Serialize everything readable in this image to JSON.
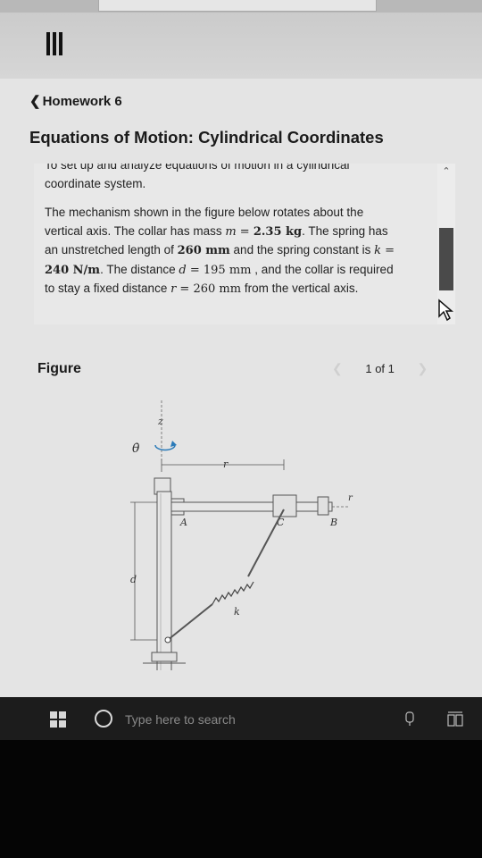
{
  "nav": {
    "back_label": "Homework 6"
  },
  "page": {
    "title": "Equations of Motion: Cylindrical Coordinates"
  },
  "problem": {
    "cut_line": "To set up and analyze equations of motion in a cylindrical",
    "intro_tail": "coordinate system.",
    "p1": "The mechanism shown in the figure below rotates about the vertical axis. The collar has mass ",
    "m_sym": "m",
    "eq": " = ",
    "m_val": "2.35 kg",
    "p2": ". The spring has an unstretched length of ",
    "len_val": "260 mm",
    "p3": " and the spring constant is ",
    "k_sym": "k",
    "k_val": "240 N/m",
    "p4": ". The distance ",
    "d_sym": "d",
    "d_val": "195 mm",
    "p5": " , and the collar is required to stay a fixed distance ",
    "r_sym": "r",
    "r_val": "260 mm",
    "p6": " from the vertical axis."
  },
  "figure_panel": {
    "label": "Figure",
    "pager": "1 of 1",
    "prev_icon": "chevron-left-icon",
    "next_icon": "chevron-right-icon",
    "labels": {
      "z": "z",
      "theta_dot": "θ̇",
      "r_top": "r",
      "r_right": "r",
      "A": "A",
      "C": "C",
      "B": "B",
      "d": "d",
      "k": "k"
    }
  },
  "taskbar": {
    "search_placeholder": "Type here to search",
    "start_icon": "windows-logo-icon",
    "cortana_icon": "circle-icon"
  },
  "colors": {
    "taskbar": "#1c1c1c",
    "background": "#e4e4e4",
    "scroll_thumb": "#4a4a4a"
  }
}
